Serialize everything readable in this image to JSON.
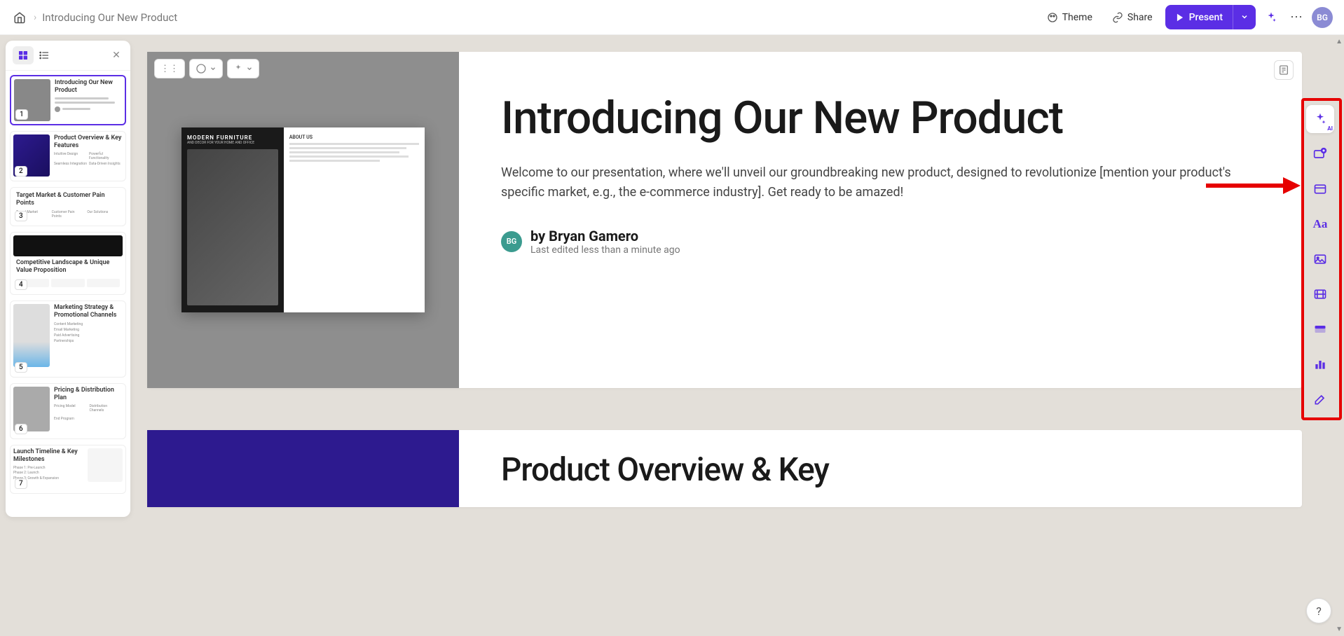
{
  "topbar": {
    "title": "Introducing Our New Product",
    "theme_label": "Theme",
    "share_label": "Share",
    "present_label": "Present",
    "avatar_initials": "BG"
  },
  "slide_panel": {
    "thumbs": [
      {
        "num": "1",
        "title": "Introducing Our New Product"
      },
      {
        "num": "2",
        "title": "Product Overview & Key Features"
      },
      {
        "num": "3",
        "title": "Target Market & Customer Pain Points"
      },
      {
        "num": "4",
        "title": "Competitive Landscape & Unique Value Proposition"
      },
      {
        "num": "5",
        "title": "Marketing Strategy & Promotional Channels"
      },
      {
        "num": "6",
        "title": "Pricing & Distribution Plan"
      },
      {
        "num": "7",
        "title": "Launch Timeline & Key Milestones"
      }
    ]
  },
  "slide1": {
    "heading": "Introducing Our New Product",
    "description": "Welcome to our presentation, where we'll unveil our groundbreaking new product, designed to revolutionize [mention your product's specific market, e.g., the e-commerce industry]. Get ready to be amazed!",
    "brochure_title": "MODERN FURNITURE",
    "brochure_sub": "AND DECOR FOR YOUR HOME AND OFFICE",
    "brochure_about": "ABOUT US",
    "author_initials": "BG",
    "author_name": "by Bryan Gamero",
    "edited": "Last edited less than a minute ago"
  },
  "slide2": {
    "heading": "Product Overview & Key"
  },
  "right_rail": {
    "ai_badge": "AI"
  },
  "help": "?"
}
